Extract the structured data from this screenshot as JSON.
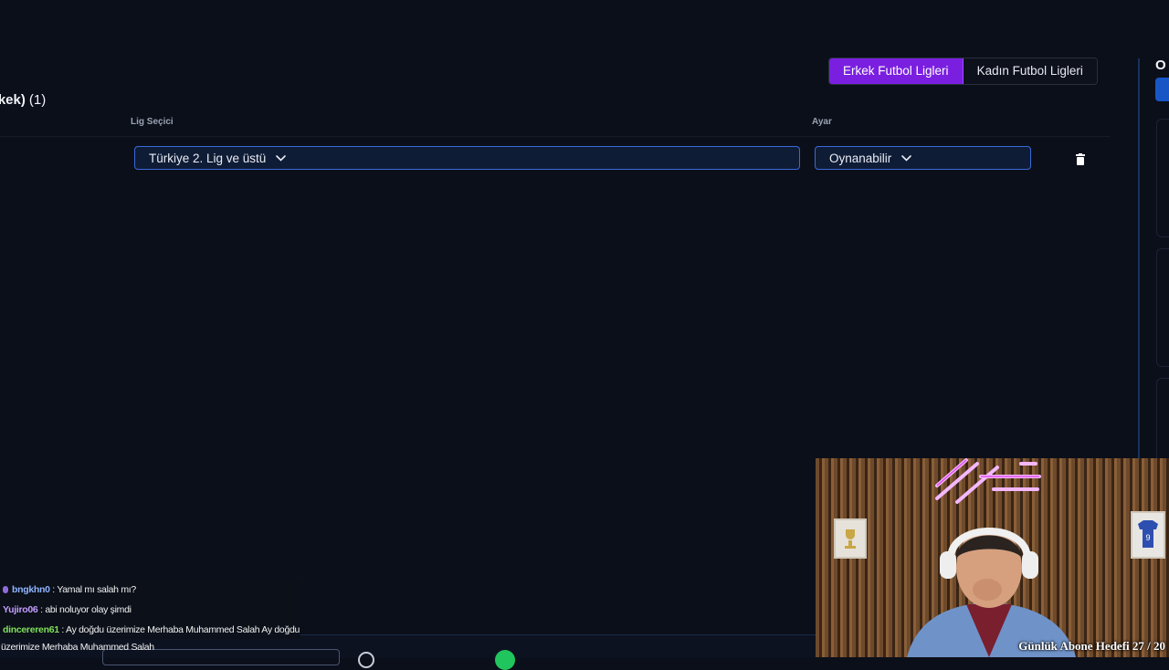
{
  "league_toggle": {
    "men_label": "Erkek Futbol Ligleri",
    "women_label": "Kadın Futbol Ligleri",
    "active": "men"
  },
  "section": {
    "title": "rkek)",
    "count": "(1)"
  },
  "table": {
    "league_selector_header": "Lig Seçici",
    "setting_header": "Ayar",
    "rows": [
      {
        "league_value": "Türkiye 2. Lig ve üstü",
        "setting_value": "Oynanabilir"
      }
    ]
  },
  "right_panel": {
    "heading_letter": "O"
  },
  "chat": {
    "messages": [
      {
        "user": "bngkhn0",
        "text": ": Yamal mı salah mı?",
        "user_color": "#8fb4ff"
      },
      {
        "user": "Yujiro06",
        "text": ": abi noluyor olay şimdi",
        "user_color": "#c49cff"
      },
      {
        "user": "dincereren61",
        "text": ": Ay doğdu üzerimize Merhaba Muhammed Salah Ay doğdu",
        "user_color": "#7fe05a"
      }
    ],
    "wrapped_continuation": "üzerimize Merhaba Muhammed Salah"
  },
  "stream_overlay": {
    "goal_text": "Günlük Abone Hedefi 27 / 20"
  },
  "colors": {
    "accent_purple": "#7a1fe0",
    "field_border": "#3a6ad8",
    "background": "#0b0f1a"
  },
  "icons": {
    "dropdown": "chevron-down-icon",
    "delete": "trash-icon"
  }
}
